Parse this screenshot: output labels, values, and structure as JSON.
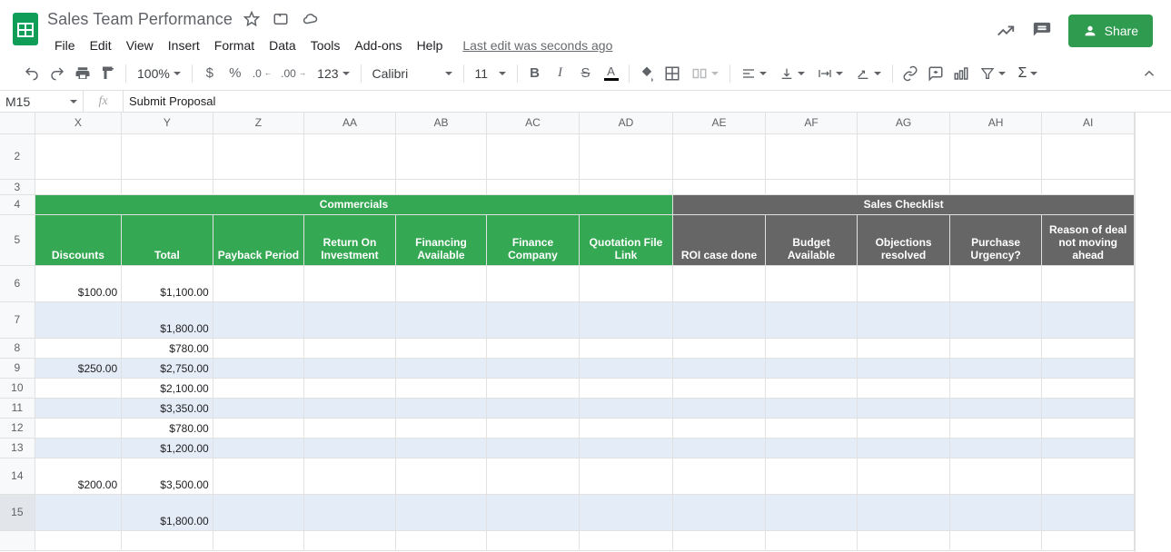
{
  "doc": {
    "title": "Sales Team Performance",
    "last_edit": "Last edit was seconds ago"
  },
  "menus": [
    "File",
    "Edit",
    "View",
    "Insert",
    "Format",
    "Data",
    "Tools",
    "Add-ons",
    "Help"
  ],
  "share_label": "Share",
  "toolbar": {
    "zoom": "100%",
    "font": "Calibri",
    "size": "11",
    "more_formats": "123"
  },
  "namebox": "M15",
  "formula": "Submit Proposal",
  "cols": [
    "X",
    "Y",
    "Z",
    "AA",
    "AB",
    "AC",
    "AD",
    "AE",
    "AF",
    "AG",
    "AH",
    "AI"
  ],
  "section_heads": {
    "commercials": "Commercials",
    "checklist": "Sales Checklist"
  },
  "col_heads": {
    "X": "Discounts",
    "Y": "Total",
    "Z": "Payback Period",
    "AA": "Return On Investment",
    "AB": "Financing Available",
    "AC": "Finance Company",
    "AD": "Quotation File Link",
    "AE": "ROI case done",
    "AF": "Budget Available",
    "AG": "Objections resolved",
    "AH": "Purchase Urgency?",
    "AI": "Reason of deal not moving ahead"
  },
  "rows": {
    "2": {},
    "3": {},
    "4": {},
    "5": {},
    "6": {
      "X": "$100.00",
      "Y": "$1,100.00"
    },
    "7": {
      "Y": "$1,800.00"
    },
    "8": {
      "Y": "$780.00"
    },
    "9": {
      "X": "$250.00",
      "Y": "$2,750.00"
    },
    "10": {
      "Y": "$2,100.00"
    },
    "11": {
      "Y": "$3,350.00"
    },
    "12": {
      "Y": "$780.00"
    },
    "13": {
      "Y": "$1,200.00"
    },
    "14": {
      "X": "$200.00",
      "Y": "$3,500.00"
    },
    "15": {
      "Y": "$1,800.00"
    }
  },
  "row_nums": [
    "2",
    "3",
    "4",
    "5",
    "6",
    "7",
    "8",
    "9",
    "10",
    "11",
    "12",
    "13",
    "14",
    "15"
  ]
}
